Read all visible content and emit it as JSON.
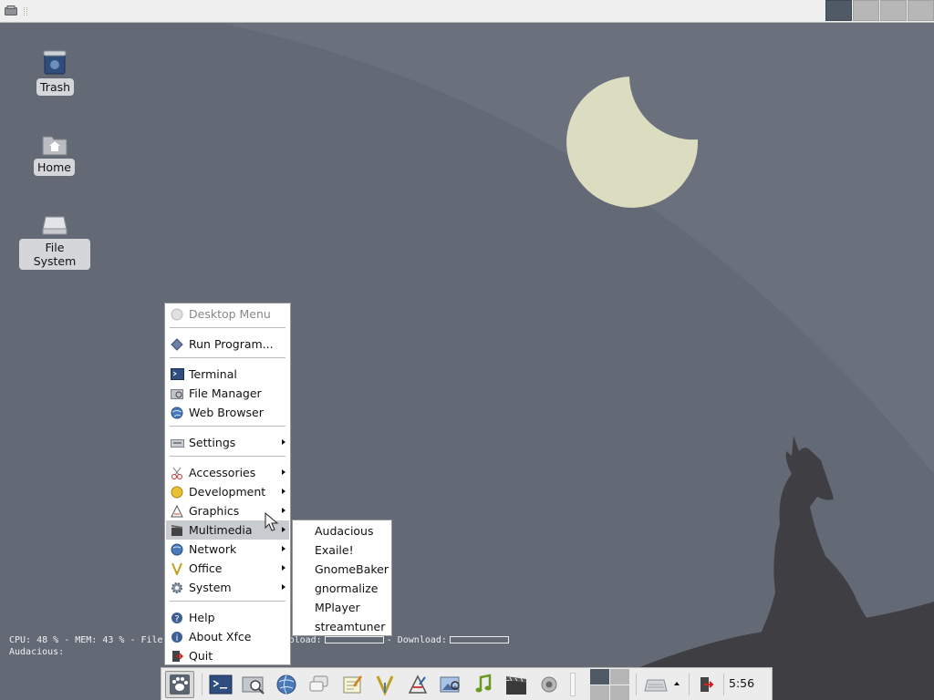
{
  "desktop": {
    "icons": [
      {
        "name": "trash",
        "label": "Trash"
      },
      {
        "name": "home",
        "label": "Home"
      },
      {
        "name": "filesystem",
        "label": "File System"
      }
    ]
  },
  "conky": {
    "line1_stats": "CPU: 48 % - MEM: 43 % - File",
    "upload_label": "pload:",
    "download_label": "- Download:",
    "line2": "Audacious:"
  },
  "menu": {
    "header": "Desktop Menu",
    "run_program": "Run Program...",
    "terminal": "Terminal",
    "file_manager": "File Manager",
    "web_browser": "Web Browser",
    "settings": "Settings",
    "accessories": "Accessories",
    "development": "Development",
    "graphics": "Graphics",
    "multimedia": "Multimedia",
    "network": "Network",
    "office": "Office",
    "system": "System",
    "help": "Help",
    "about": "About Xfce",
    "quit": "Quit"
  },
  "submenu": {
    "items": [
      "Audacious",
      "Exaile!",
      "GnomeBaker",
      "gnormalize",
      "MPlayer",
      "streamtuner"
    ]
  },
  "panel": {
    "clock": "5:56",
    "top_workspaces_active": 1,
    "bottom_workspaces_active": 1
  },
  "colors": {
    "desktop_bg": "#6a717d",
    "moon": "#dcdcc0",
    "menu_highlight": "#c8cbcf",
    "workspace_active": "#505a65"
  }
}
